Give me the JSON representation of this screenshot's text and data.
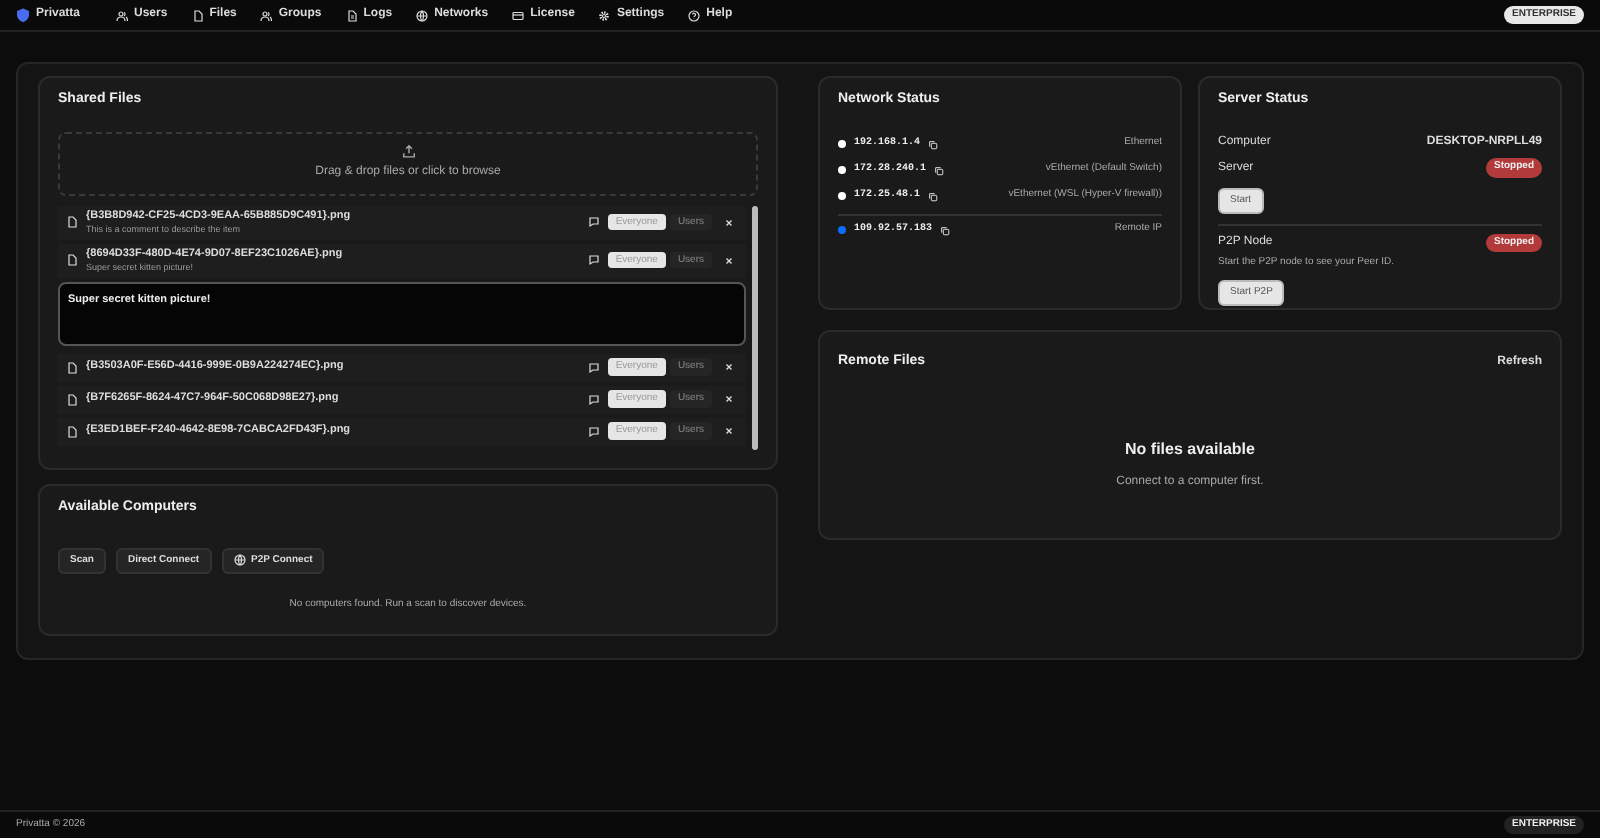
{
  "nav": {
    "brand": "Privatta",
    "items": [
      {
        "label": "Users"
      },
      {
        "label": "Files"
      },
      {
        "label": "Groups"
      },
      {
        "label": "Logs"
      },
      {
        "label": "Networks"
      },
      {
        "label": "License"
      },
      {
        "label": "Settings"
      },
      {
        "label": "Help"
      }
    ],
    "badge": "ENTERPRISE"
  },
  "shared_files": {
    "title": "Shared Files",
    "dropzone": "Drag & drop files or click to browse",
    "files": [
      {
        "name": "{B3B8D942-CF25-4CD3-9EAA-65B885D9C491}.png",
        "comment": "This is a comment to describe the item",
        "editing": false,
        "options": [
          {
            "label": "Everyone",
            "selected": true
          },
          {
            "label": "Users",
            "selected": false
          }
        ]
      },
      {
        "name": "{8694D33F-480D-4E74-9D07-8EF23C1026AE}.png",
        "comment": "Super secret kitten picture!",
        "editing": true,
        "draft": "Super secret kitten picture!",
        "options": [
          {
            "label": "Everyone",
            "selected": true
          },
          {
            "label": "Users",
            "selected": false
          }
        ]
      },
      {
        "name": "{B3503A0F-E56D-4416-999E-0B9A224274EC}.png",
        "editing": false,
        "options": [
          {
            "label": "Everyone",
            "selected": true
          },
          {
            "label": "Users",
            "selected": false
          }
        ]
      },
      {
        "name": "{B7F6265F-8624-47C7-964F-50C068D98E27}.png",
        "editing": false,
        "options": [
          {
            "label": "Everyone",
            "selected": true
          },
          {
            "label": "Users",
            "selected": false
          }
        ]
      },
      {
        "name": "{E3ED1BEF-F240-4642-8E98-7CABCA2FD43F}.png",
        "editing": false,
        "options": [
          {
            "label": "Everyone",
            "selected": true
          },
          {
            "label": "Users",
            "selected": false
          }
        ]
      }
    ]
  },
  "available_computers": {
    "title": "Available Computers",
    "buttons": [
      "Scan",
      "Direct Connect",
      "P2P Connect"
    ],
    "empty": "No computers found. Run a scan to discover devices."
  },
  "network_status": {
    "title": "Network Status",
    "interfaces": [
      {
        "ip": "192.168.1.4",
        "label": "Ethernet",
        "color": "#ffffff"
      },
      {
        "ip": "172.28.240.1",
        "label": "vEthernet (Default Switch)",
        "color": "#ffffff"
      },
      {
        "ip": "172.25.48.1",
        "label": "vEthernet (WSL (Hyper-V firewall))",
        "color": "#ffffff"
      }
    ],
    "remote": {
      "ip": "109.92.57.183",
      "label": "Remote IP",
      "color": "#0d6efd"
    }
  },
  "server_status": {
    "title": "Server Status",
    "computer_label": "Computer",
    "computer": "DESKTOP-NRPLL49",
    "server_label": "Server",
    "server_state": "Stopped",
    "server_button": "Start",
    "p2p_label": "P2P Node",
    "p2p_state": "Stopped",
    "p2p_hint": "Start the P2P node to see your Peer ID.",
    "p2p_button": "Start P2P"
  },
  "remote_files": {
    "title": "Remote Files",
    "refresh": "Refresh",
    "empty_title": "No files available",
    "empty_hint": "Connect to a computer first."
  },
  "footer": {
    "copyright": "Privatta © 2026",
    "badge": "ENTERPRISE"
  }
}
